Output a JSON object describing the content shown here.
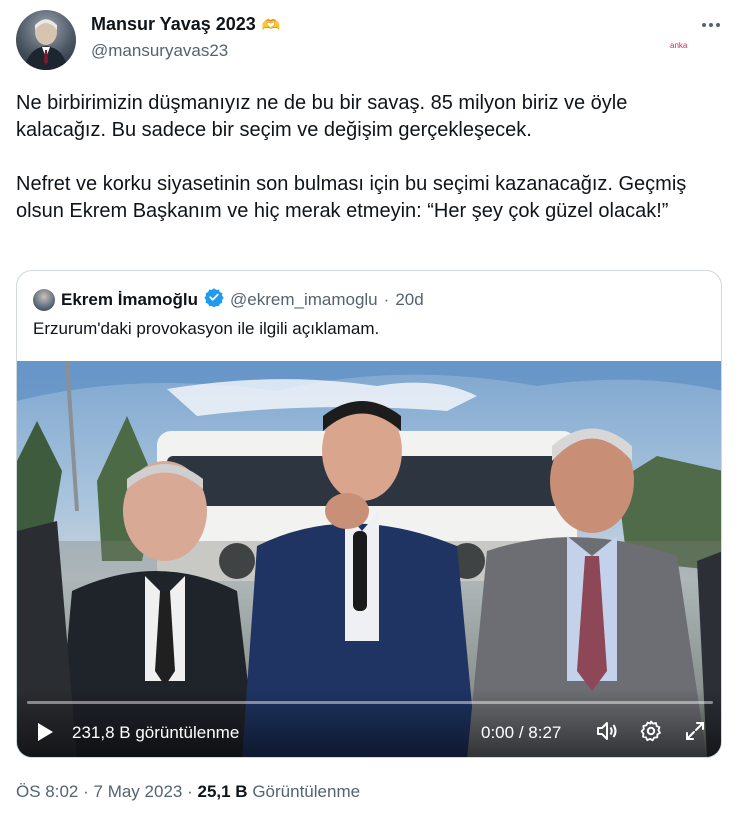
{
  "author": {
    "name": "Mansur Yavaş 2023",
    "emoji": "🫶",
    "handle": "@mansuryavas23"
  },
  "more_icon": "more-horizontal-icon",
  "watermark": "anka",
  "tweet_text": "Ne birbirimizin düşmanıyız ne de bu bir savaş. 85 milyon biriz ve öyle kalacağız. Bu sadece bir seçim ve değişim gerçekleşecek.\n\nNefret ve korku siyasetinin son bulması için bu seçimi kazanacağız. Geçmiş olsun Ekrem Başkanım ve hiç merak etmeyin: “Her şey çok güzel olacak!”",
  "quoted": {
    "name": "Ekrem İmamoğlu",
    "verified_icon": "verified-badge-icon",
    "handle": "@ekrem_imamoglu",
    "separator": "·",
    "age": "20d",
    "text": "Erzurum'daki provokasyon ile ilgili açıklamam.",
    "video": {
      "views": "231,8 B görüntülenme",
      "current_time": "0:00",
      "duration": "8:27",
      "time_sep": " / ",
      "progress": 0.0
    }
  },
  "footer": {
    "time": "ÖS 8:02",
    "date": "7 May 2023",
    "sep": "·",
    "views_count": "25,1 B",
    "views_label": "Görüntülenme"
  },
  "colors": {
    "text": "#0f1419",
    "secondary": "#536471",
    "verified": "#1d9bf0",
    "border": "#cfd9de"
  }
}
